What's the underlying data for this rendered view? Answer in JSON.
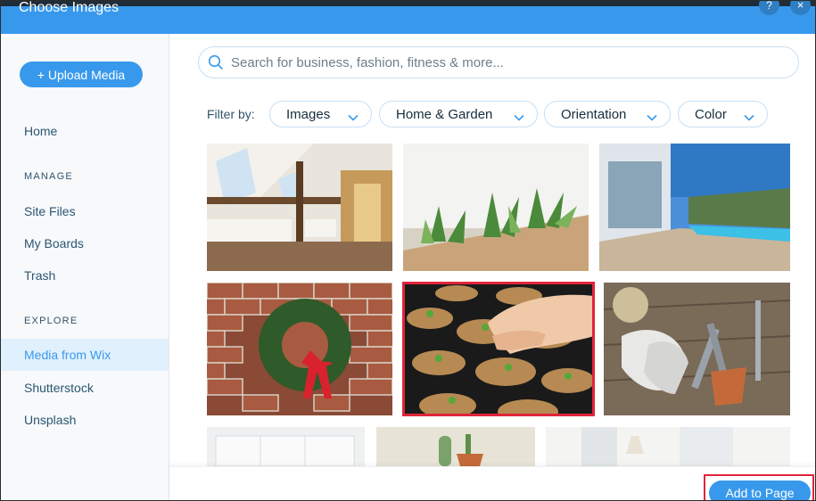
{
  "header": {
    "title": "Choose Images",
    "help_label": "?",
    "close_label": "×"
  },
  "sidebar": {
    "upload_label": "+ Upload Media",
    "home_label": "Home",
    "manage_heading": "MANAGE",
    "manage_items": [
      "Site Files",
      "My Boards",
      "Trash"
    ],
    "explore_heading": "EXPLORE",
    "explore_items": [
      "Media from Wix",
      "Shutterstock",
      "Unsplash"
    ],
    "active_item": "Media from Wix"
  },
  "search": {
    "placeholder": "Search for business, fashion, fitness & more...",
    "value": ""
  },
  "filters": {
    "label": "Filter by:",
    "chips": [
      "Images",
      "Home & Garden",
      "Orientation",
      "Color"
    ]
  },
  "gallery": {
    "images": [
      {
        "name": "attic-bedroom"
      },
      {
        "name": "succulent-planter"
      },
      {
        "name": "modern-house-pool"
      },
      {
        "name": "christmas-wreath"
      },
      {
        "name": "planting-seedlings",
        "selected": true
      },
      {
        "name": "garden-gloves-tools"
      },
      {
        "name": "white-kitchen"
      },
      {
        "name": "cactus-pots"
      },
      {
        "name": "bright-living-room"
      }
    ]
  },
  "footer": {
    "add_label": "Add to Page"
  },
  "colors": {
    "accent": "#3899ec",
    "highlight": "#e1253a",
    "active_bg": "#e1f0fd"
  }
}
